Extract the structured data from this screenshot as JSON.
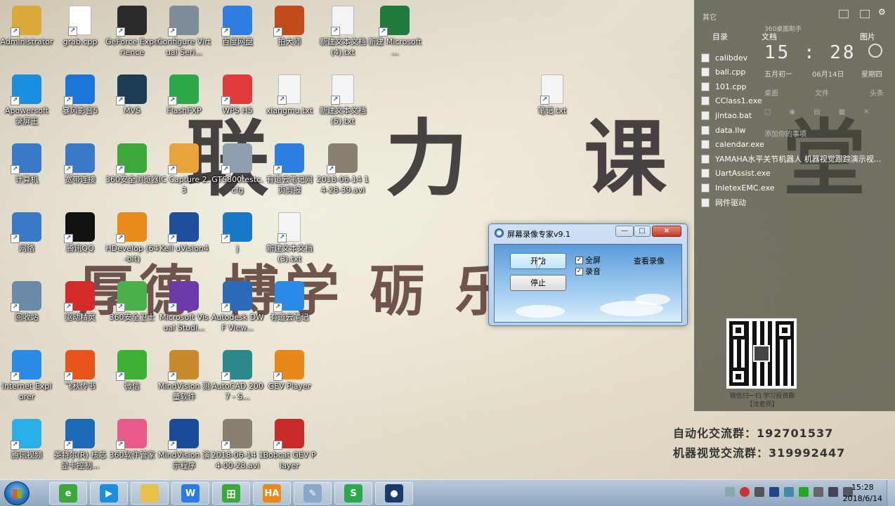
{
  "wallpaper": {
    "headline": "联 力 课 堂",
    "motto": "厚德  博学    砺        乐群",
    "contact_line1_label": "自动化交流群：",
    "contact_line1_value": "192701537",
    "contact_line2_label": "机器视觉交流群：",
    "contact_line2_value": "319992447",
    "qr_caption_line1": "微信扫一扫 学习投资群",
    "qr_caption_line2": "【沈老师】"
  },
  "desktop_icons": [
    {
      "label": "Administrator",
      "icon": "user-folder-icon",
      "color": "#d9a93a"
    },
    {
      "label": "grab.cpp",
      "icon": "cpp-file-icon",
      "color": "#ffffff"
    },
    {
      "label": "GeForce Experience",
      "icon": "nvidia-icon",
      "color": "#2b2b2b"
    },
    {
      "label": "Configure Virtual Seri...",
      "icon": "virtual-serial-icon",
      "color": "#7e8c9a"
    },
    {
      "label": "百度网盘",
      "icon": "baidu-netdisk-icon",
      "color": "#2f7de1"
    },
    {
      "label": "拍大师",
      "icon": "paidashi-icon",
      "color": "#c04a1a"
    },
    {
      "label": "新建文本文档 (4).txt",
      "icon": "text-file-icon",
      "color": "#f4f4f4"
    },
    {
      "label": "新建 Microsoft ...",
      "icon": "excel-icon",
      "color": "#1f7a3e"
    },
    {
      "label": "Apowersoft 录屏王",
      "icon": "apowersoft-icon",
      "color": "#1a8fe0"
    },
    {
      "label": "暴风影音5",
      "icon": "baofeng-icon",
      "color": "#1877d8"
    },
    {
      "label": "MVS",
      "icon": "mvs-icon",
      "color": "#1a3d55"
    },
    {
      "label": "FlashFXP",
      "icon": "flashfxp-icon",
      "color": "#2aa84a"
    },
    {
      "label": "WPS H5",
      "icon": "wps-h5-icon",
      "color": "#e03a3a"
    },
    {
      "label": "xiangmu.txt",
      "icon": "text-file-icon",
      "color": "#f4f4f4"
    },
    {
      "label": "新建文本文档 (5).txt",
      "icon": "text-file-icon",
      "color": "#f4f4f4"
    },
    {
      "label": "笔记.txt",
      "icon": "text-file-icon",
      "color": "#f4f4f4"
    },
    {
      "label": "计算机",
      "icon": "computer-icon",
      "color": "#3a78c8"
    },
    {
      "label": "宽带连接",
      "icon": "network-connection-icon",
      "color": "#3a78c8"
    },
    {
      "label": "360安全浏览器",
      "icon": "360-browser-icon",
      "color": "#3ca83c"
    },
    {
      "label": "IC Capture 2.3",
      "icon": "ic-capture-icon",
      "color": "#e8a33a"
    },
    {
      "label": "GTS800testc.cfg",
      "icon": "config-file-icon",
      "color": "#8ea0b0"
    },
    {
      "label": "有道云笔记网页剪报",
      "icon": "youdao-clip-icon",
      "color": "#2a7fe0"
    },
    {
      "label": "2018-06-14 14-28-39.avi",
      "icon": "video-file-icon",
      "color": "#8a8070"
    },
    {
      "label": "网络",
      "icon": "network-icon",
      "color": "#3a78c8"
    },
    {
      "label": "腾讯QQ",
      "icon": "qq-icon",
      "color": "#111111"
    },
    {
      "label": "HDevelop (64-bit)",
      "icon": "hdevelop-icon",
      "color": "#e88a1a"
    },
    {
      "label": "Keil uVision4",
      "icon": "keil-icon",
      "color": "#1d4f9c"
    },
    {
      "label": "j",
      "icon": "app-j-icon",
      "color": "#1a78c8"
    },
    {
      "label": "新建文本文档 (3).txt",
      "icon": "text-file-icon",
      "color": "#f4f4f4"
    },
    {
      "label": "回收站",
      "icon": "recycle-bin-icon",
      "color": "#6a8aa8"
    },
    {
      "label": "驱动精灵",
      "icon": "qudong-icon",
      "color": "#d62a2a"
    },
    {
      "label": "360安全卫士",
      "icon": "360-safe-icon",
      "color": "#4ab04a"
    },
    {
      "label": "Microsoft Visual Studi...",
      "icon": "visual-studio-icon",
      "color": "#6a3aa8"
    },
    {
      "label": "Autodesk DWF View...",
      "icon": "autodesk-dwf-icon",
      "color": "#2a6ab8"
    },
    {
      "label": "有道云笔记",
      "icon": "youdao-note-icon",
      "color": "#2a8ae8"
    },
    {
      "label": "Internet Explorer",
      "icon": "ie-icon",
      "color": "#2a8ae8"
    },
    {
      "label": "飞秋传书",
      "icon": "feiqiu-icon",
      "color": "#e8551a"
    },
    {
      "label": "微信",
      "icon": "wechat-icon",
      "color": "#3cb034"
    },
    {
      "label": "MindVision 测量软件",
      "icon": "mindvision-measure-icon",
      "color": "#c88a2a"
    },
    {
      "label": "AutoCAD 2007 - S...",
      "icon": "autocad-icon",
      "color": "#2a8a8a"
    },
    {
      "label": "GEV Player",
      "icon": "gev-player-icon",
      "color": "#e8881a"
    },
    {
      "label": "腾讯视频",
      "icon": "tencent-video-icon",
      "color": "#2ab0e8"
    },
    {
      "label": "英特尔(R) 核芯显卡控制...",
      "icon": "intel-graphics-icon",
      "color": "#1a6ab8"
    },
    {
      "label": "360软件管家",
      "icon": "360-software-icon",
      "color": "#e85a8a"
    },
    {
      "label": "MindVision 演示程序",
      "icon": "mindvision-demo-icon",
      "color": "#1a4a9a"
    },
    {
      "label": "2018-06-14 14-00-28.avi",
      "icon": "video-file-icon",
      "color": "#8a8070"
    },
    {
      "label": "Bobcat GEV Player",
      "icon": "bobcat-icon",
      "color": "#c82a2a"
    }
  ],
  "sidebar": {
    "header_label": "其它",
    "tabs": [
      "目录",
      "文档",
      "图片"
    ],
    "widget_title": "360桌面助手",
    "time": "15 : 28",
    "lunar": "五月初一",
    "date": "06月14日",
    "weekday": "星期四",
    "quick_menu": [
      "桌面",
      "文件",
      "头条"
    ],
    "add_hint": "添加你的事项",
    "recent_files": [
      "calibdev",
      "ball.cpp",
      "101.cpp",
      "CClass1.exe",
      "jintao.bat",
      "data.llw",
      "calendar.exe",
      "YAMAHA水平关节机器人 机器视觉跟踪演示视...",
      "UartAssist.exe",
      "InletexEMC.exe",
      "网件驱动"
    ]
  },
  "dialog": {
    "title": "屏幕录像专家v9.1",
    "start_label": "开始",
    "stop_label": "停止",
    "fullscreen_label": "全屏",
    "audio_label": "录音",
    "view_label": "查看录像",
    "fullscreen_checked": true,
    "audio_checked": true,
    "minimize_label": "—",
    "maximize_label": "□",
    "close_label": "×"
  },
  "taskbar": {
    "items": [
      {
        "name": "360-browser-taskbar",
        "glyph": "e",
        "color": "#3ca83c"
      },
      {
        "name": "apowersoft-taskbar",
        "glyph": "▶",
        "color": "#1a8fe0"
      },
      {
        "name": "explorer-taskbar",
        "glyph": "",
        "color": "#e8c04a"
      },
      {
        "name": "wps-writer-taskbar",
        "glyph": "W",
        "color": "#2a7ae8"
      },
      {
        "name": "app-green-taskbar",
        "glyph": "田",
        "color": "#3aa83a"
      },
      {
        "name": "hdevelop-taskbar",
        "glyph": "HA",
        "color": "#e88a1a"
      },
      {
        "name": "paint-taskbar",
        "glyph": "✎",
        "color": "#8aa8c8"
      },
      {
        "name": "wps-sheet-taskbar",
        "glyph": "S",
        "color": "#2aa84a"
      },
      {
        "name": "screen-recorder-taskbar",
        "glyph": "●",
        "color": "#1a3a6a"
      }
    ],
    "clock_time": "15:28",
    "clock_date": "2018/6/14"
  }
}
